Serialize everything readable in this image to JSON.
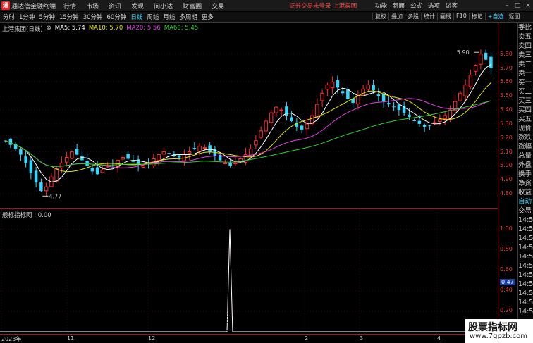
{
  "titlebar": {
    "app_name": "通达信金融终端",
    "menu": [
      "行情",
      "市场",
      "资讯",
      "发现",
      "问小达",
      "财富圈",
      "交易"
    ],
    "notice": "证券交易未登录   上港集团",
    "right_menu": [
      "功能",
      "新面",
      "公式",
      "选项",
      "游客"
    ]
  },
  "toolbar": {
    "periods": [
      "分时",
      "1分钟",
      "5分钟",
      "15分钟",
      "30分钟",
      "60分钟",
      "日线",
      "周线",
      "月线",
      "多周期",
      "更多"
    ],
    "active_period": "日线",
    "tools": [
      "复权",
      "叠加",
      "多股",
      "统计",
      "画线",
      "F10",
      "标记",
      "+自选",
      "返回"
    ]
  },
  "chart": {
    "stock_label": "上港集团(日线)",
    "ma5": "MA5: 5.74",
    "ma10": "MA10: 5.70",
    "ma20": "MA20: 5.56",
    "ma60": "MA60: 5.45",
    "high_marker": "5.90",
    "low_marker": "4.77",
    "colors": {
      "up": "#ff3030",
      "down": "#37d8ff",
      "ma5": "#ffffff",
      "ma10": "#e6e600",
      "ma20": "#e040e0",
      "ma60": "#30d030"
    }
  },
  "chart_data": {
    "type": "candlestick",
    "y_ticks": [
      "5.80",
      "5.70",
      "5.60",
      "5.50",
      "5.40",
      "5.30",
      "5.20",
      "5.10",
      "5.00",
      "4.90",
      "4.80"
    ],
    "ylim": [
      4.75,
      5.95
    ],
    "x_labels": [
      "2023年",
      "11",
      "12",
      "2",
      "3",
      "4"
    ],
    "closes": [
      5.18,
      5.15,
      5.12,
      5.08,
      5.02,
      4.95,
      4.88,
      4.82,
      4.85,
      4.92,
      4.98,
      5.02,
      5.06,
      5.1,
      5.08,
      5.04,
      5.0,
      4.96,
      4.94,
      4.97,
      5.0,
      5.02,
      5.04,
      5.06,
      5.05,
      5.03,
      5.01,
      5.0,
      5.02,
      5.05,
      5.08,
      5.1,
      5.09,
      5.07,
      5.06,
      5.08,
      5.1,
      5.12,
      5.14,
      5.13,
      5.1,
      5.07,
      5.04,
      5.02,
      5.0,
      5.02,
      5.05,
      5.08,
      5.12,
      5.18,
      5.25,
      5.32,
      5.38,
      5.42,
      5.4,
      5.36,
      5.32,
      5.28,
      5.26,
      5.3,
      5.36,
      5.44,
      5.52,
      5.58,
      5.6,
      5.56,
      5.52,
      5.48,
      5.45,
      5.5,
      5.55,
      5.58,
      5.54,
      5.5,
      5.46,
      5.44,
      5.42,
      5.4,
      5.38,
      5.35,
      5.32,
      5.3,
      5.28,
      5.29,
      5.31,
      5.33,
      5.36,
      5.4,
      5.46,
      5.52,
      5.58,
      5.65,
      5.72,
      5.8,
      5.76,
      5.7
    ],
    "indicator": {
      "title": "般标指标网 : 0.00",
      "y_ticks": [
        "1.00",
        "0.80",
        "0.60",
        "0.40",
        "0.20"
      ],
      "ylim": [
        0,
        1.1
      ],
      "current_value_label": "0.47",
      "spike_index": 50,
      "spike_value": 1.0
    }
  },
  "sidepanel": {
    "rows": [
      "委比",
      "卖五",
      "卖四",
      "卖三",
      "卖二",
      "卖一",
      "买一",
      "买二",
      "买三",
      "买四",
      "买五",
      "现价",
      "涨跌",
      "涨幅",
      "总量",
      "外盘",
      "换手",
      "净资",
      "收益",
      "自动",
      "交易",
      "14:56",
      "14:56",
      "14:56",
      "14:56",
      "14:56",
      "14:56",
      "14:56",
      "14:56",
      "14:56",
      "14:56",
      "14:56"
    ]
  },
  "watermark": {
    "line1": "股票指标网",
    "line2": "www.7gpzb.com"
  }
}
